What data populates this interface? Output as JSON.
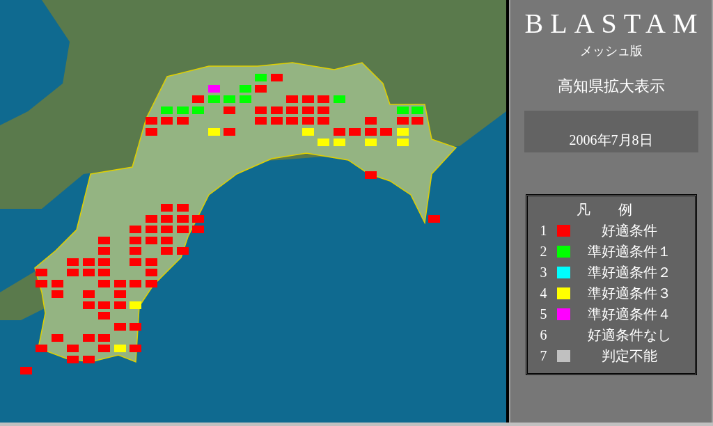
{
  "panel": {
    "title": "BLASTAM",
    "subtitle": "メッシュ版",
    "view": "高知県拡大表示",
    "date": "2006年7月8日"
  },
  "legend": {
    "title": "凡　　例",
    "items": [
      {
        "number": "1",
        "label": "好適条件",
        "color": "#ff0000"
      },
      {
        "number": "2",
        "label": "準好適条件１",
        "color": "#00ff00"
      },
      {
        "number": "3",
        "label": "準好適条件２",
        "color": "#00ffff"
      },
      {
        "number": "4",
        "label": "準好適条件３",
        "color": "#ffff00"
      },
      {
        "number": "5",
        "label": "準好適条件４",
        "color": "#ff00ff"
      },
      {
        "number": "6",
        "label": "好適条件なし"
      },
      {
        "number": "7",
        "label": "判定不能",
        "color": "#c0c0c0"
      }
    ]
  }
}
